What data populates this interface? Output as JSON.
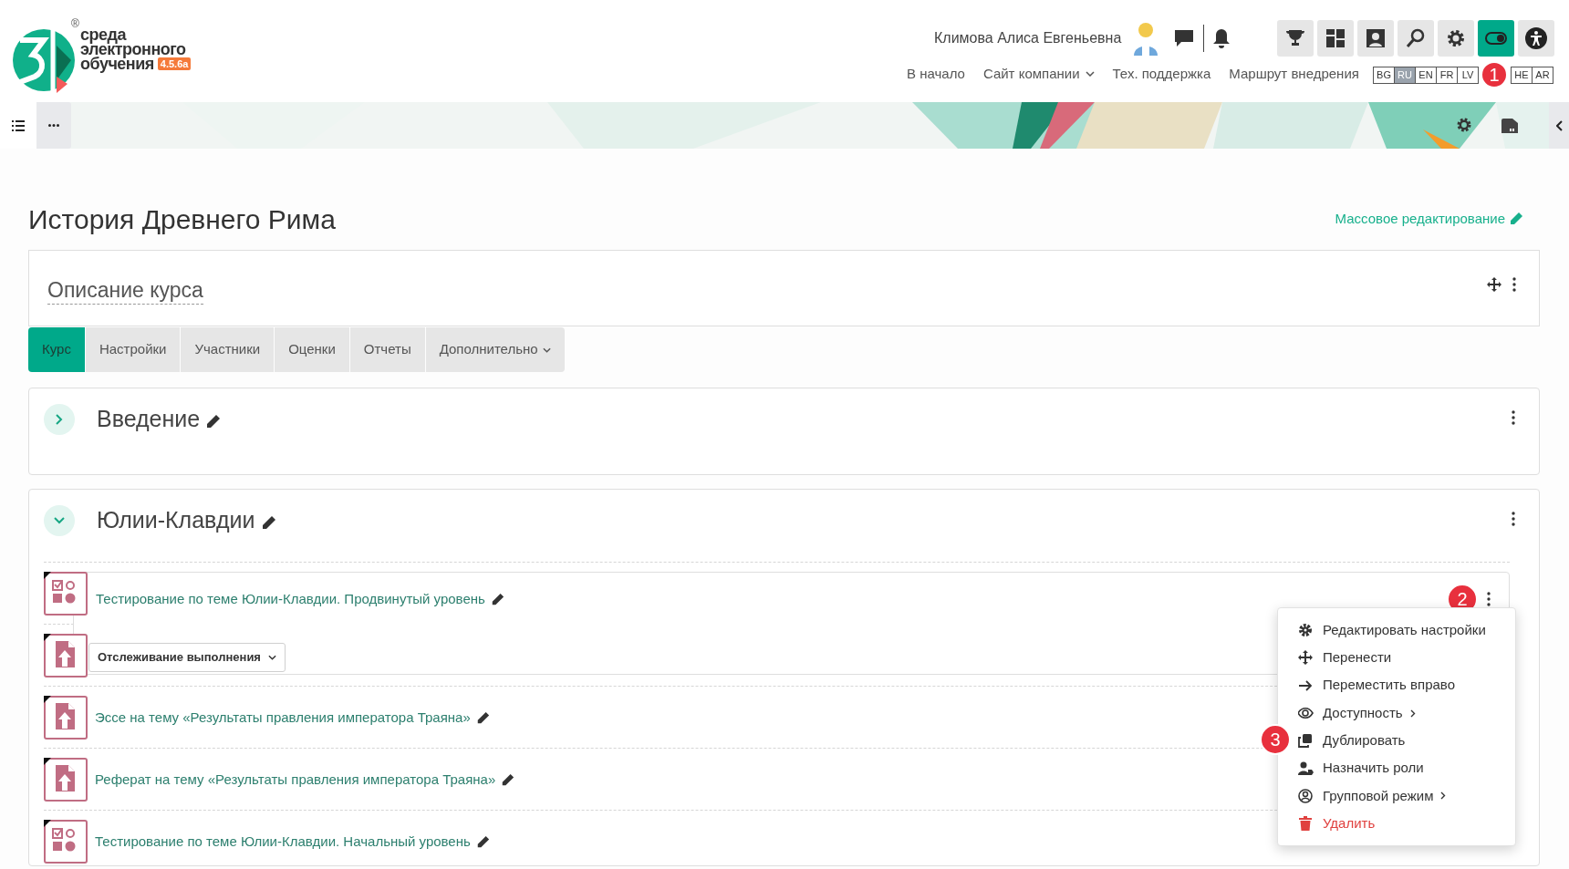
{
  "header": {
    "logo": {
      "registered": "®",
      "lines": [
        "среда",
        "электронного",
        "обучения"
      ],
      "version": "4.5.6a"
    },
    "user_name": "Климова Алиса Евгеньевна",
    "toolbar_buttons": [
      {
        "kind": "trophy",
        "active": false
      },
      {
        "kind": "dashboard",
        "active": false
      },
      {
        "kind": "portrait",
        "active": false
      },
      {
        "kind": "search",
        "active": false
      },
      {
        "kind": "settings",
        "active": false
      },
      {
        "kind": "toggle",
        "active": true
      },
      {
        "kind": "accessibility",
        "active": false
      }
    ],
    "nav": [
      {
        "label": "В начало",
        "dropdown": false
      },
      {
        "label": "Сайт компании",
        "dropdown": true
      },
      {
        "label": "Тех. поддержка",
        "dropdown": false
      },
      {
        "label": "Маршрут внедрения",
        "dropdown": false
      }
    ],
    "languages": [
      {
        "code": "BG",
        "selected": false
      },
      {
        "code": "RU",
        "selected": true
      },
      {
        "code": "EN",
        "selected": false
      },
      {
        "code": "FR",
        "selected": false
      },
      {
        "code": "LV",
        "selected": false
      },
      {
        "code": "HE",
        "selected": false
      },
      {
        "code": "AR",
        "selected": false
      }
    ]
  },
  "callouts": [
    "1",
    "2",
    "3"
  ],
  "course": {
    "title": "История Древнего Рима",
    "bulk_edit": "Массовое редактирование",
    "description_title": "Описание курса"
  },
  "tabs": [
    {
      "label": "Курс",
      "selected": true,
      "dropdown": false
    },
    {
      "label": "Настройки",
      "selected": false,
      "dropdown": false
    },
    {
      "label": "Участники",
      "selected": false,
      "dropdown": false
    },
    {
      "label": "Оценки",
      "selected": false,
      "dropdown": false
    },
    {
      "label": "Отчеты",
      "selected": false,
      "dropdown": false
    },
    {
      "label": "Дополнительно",
      "selected": false,
      "dropdown": true
    }
  ],
  "sections": [
    {
      "title": "Введение",
      "expanded": false
    },
    {
      "title": "Юлии-Клавдии",
      "expanded": true,
      "activities": [
        {
          "kind": "quiz",
          "name": "Тестирование по теме Юлии-Клавдии. Продвинутый уровень",
          "completion": "Отслеживание выполнения"
        },
        {
          "kind": "assignment"
        },
        {
          "kind": "assignment",
          "name": "Эссе на тему «Результаты правления императора Траяна»"
        },
        {
          "kind": "assignment",
          "name": "Реферат на тему «Результаты правления императора Траяна»"
        },
        {
          "kind": "quiz",
          "name": "Тестирование по теме Юлии-Клавдии. Начальный уровень"
        }
      ]
    }
  ],
  "menu": {
    "items": [
      {
        "kind": "settings",
        "label": "Редактировать настройки",
        "submenu": false,
        "danger": false
      },
      {
        "kind": "move",
        "label": "Перенести",
        "submenu": false,
        "danger": false
      },
      {
        "kind": "indent",
        "label": "Переместить вправо",
        "submenu": false,
        "danger": false
      },
      {
        "kind": "visibility",
        "label": "Доступность",
        "submenu": true,
        "danger": false
      },
      {
        "kind": "duplicate",
        "label": "Дублировать",
        "submenu": false,
        "danger": false
      },
      {
        "kind": "roles",
        "label": "Назначить роли",
        "submenu": false,
        "danger": false
      },
      {
        "kind": "group",
        "label": "Групповой режим",
        "submenu": true,
        "danger": false
      },
      {
        "kind": "delete",
        "label": "Удалить",
        "submenu": false,
        "danger": true
      }
    ]
  }
}
